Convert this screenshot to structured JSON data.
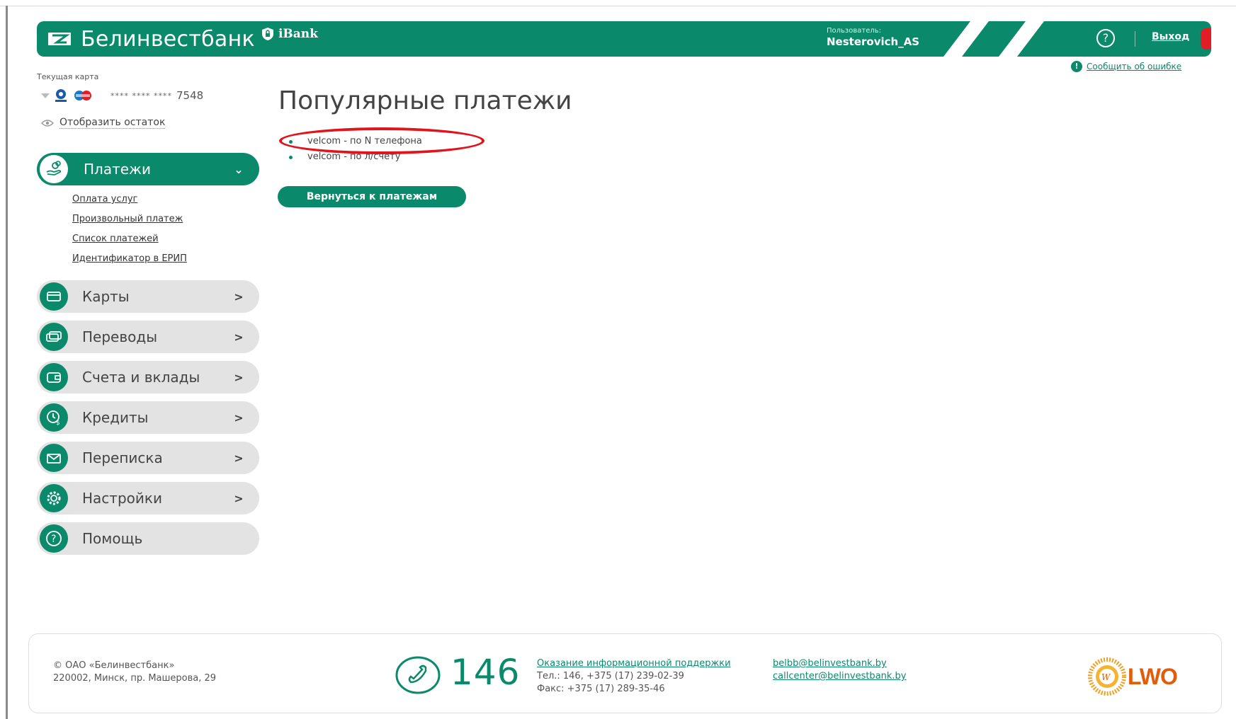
{
  "header": {
    "brand": "Белинвестбанк",
    "product": "iBank",
    "user_caption": "Пользователь:",
    "user_name": "Nesterovich_AS",
    "help": "?",
    "logout": "Выход",
    "report_error": "Сообщить об ошибке",
    "colors": {
      "brand_green": "#0a8a6a",
      "logout_red": "#e31d25"
    }
  },
  "card": {
    "caption": "Текущая карта",
    "mask": "**** **** ****",
    "last_digits": "7548",
    "show_balance": "Отобразить остаток"
  },
  "menu": {
    "payments": {
      "label": "Платежи",
      "icon": "hand-coins-icon",
      "submenu": [
        "Оплата услуг",
        "Произвольный платеж",
        "Список платежей",
        "Идентификатор в ЕРИП"
      ]
    },
    "items": [
      {
        "label": "Карты",
        "icon": "card-icon"
      },
      {
        "label": "Переводы",
        "icon": "transfer-icon"
      },
      {
        "label": "Счета и вклады",
        "icon": "wallet-icon"
      },
      {
        "label": "Кредиты",
        "icon": "clock-money-icon"
      },
      {
        "label": "Переписка",
        "icon": "envelope-icon"
      },
      {
        "label": "Настройки",
        "icon": "gear-icon"
      },
      {
        "label": "Помощь",
        "icon": "question-icon"
      }
    ]
  },
  "main": {
    "title": "Популярные платежи",
    "popular": [
      "velcom - по N телефона",
      "velcom - по л/счету"
    ],
    "back_button": "Вернуться к платежам"
  },
  "footer": {
    "company": "© ОАО «Белинвестбанк»",
    "address": "220002, Минск, пр. Машерова, 29",
    "phone_short": "146",
    "support_link": "Оказание информационной поддержки",
    "tel": "Тел.: 146, +375 (17) 239-02-39",
    "fax": "Факс: +375 (17) 289-35-46",
    "email1": "belbb@belinvestbank.by",
    "email2": "callcenter@belinvestbank.by",
    "partner": "LWO"
  }
}
